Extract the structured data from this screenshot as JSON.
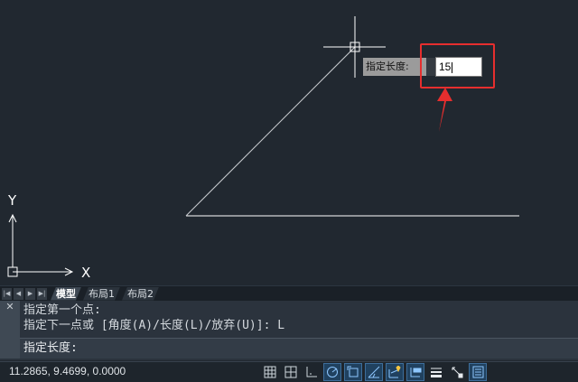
{
  "canvas": {
    "axis_labels": {
      "y": "Y",
      "x": "X"
    }
  },
  "dynamic_input": {
    "label": "指定长度:",
    "value": "15"
  },
  "layout_tabs": {
    "nav_buttons": [
      "first",
      "previous",
      "next",
      "last"
    ],
    "tabs": [
      {
        "label": "模型",
        "active": true
      },
      {
        "label": "布局1",
        "active": false
      },
      {
        "label": "布局2",
        "active": false
      }
    ]
  },
  "command_line": {
    "close_glyph": "✕",
    "history": [
      "指定第一个点:",
      "指定下一点或 [角度(A)/长度(L)/放弃(U)]: L"
    ],
    "prompt": "指定长度:"
  },
  "status_bar": {
    "coordinates": "11.2865, 9.4699, 0.0000",
    "icons": [
      {
        "name": "grid-display-icon",
        "on": false
      },
      {
        "name": "snap-mode-icon",
        "on": false
      },
      {
        "name": "ortho-mode-icon",
        "on": false
      },
      {
        "name": "polar-tracking-icon",
        "on": true
      },
      {
        "name": "object-snap-icon",
        "on": true
      },
      {
        "name": "isometric-drafting-icon",
        "on": true
      },
      {
        "name": "object-snap-tracking-icon",
        "on": true
      },
      {
        "name": "dynamic-ucs-icon",
        "on": true
      },
      {
        "name": "lineweight-icon",
        "on": false
      },
      {
        "name": "selection-cycling-icon",
        "on": false
      },
      {
        "name": "customization-icon",
        "on": true
      }
    ]
  },
  "colors": {
    "canvas_background": "#212830",
    "geometry": "#ffffff",
    "highlight": "#e62e2e"
  }
}
